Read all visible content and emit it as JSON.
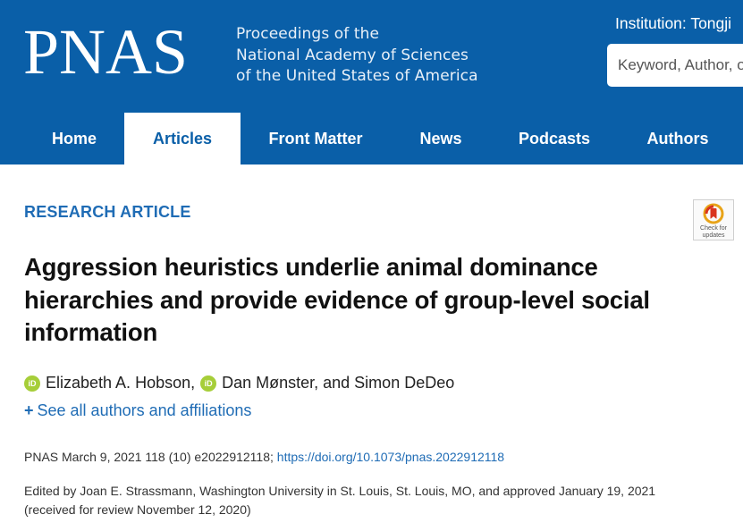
{
  "header": {
    "logo": "PNAS",
    "tagline": [
      "Proceedings of the",
      "National Academy of Sciences",
      "of the United States of America"
    ],
    "institution": "Institution: Tongji",
    "search_placeholder": "Keyword, Author, or DOI"
  },
  "nav": {
    "items": [
      {
        "label": "Home"
      },
      {
        "label": "Articles"
      },
      {
        "label": "Front Matter"
      },
      {
        "label": "News"
      },
      {
        "label": "Podcasts"
      },
      {
        "label": "Authors"
      }
    ],
    "active": "Articles"
  },
  "article": {
    "type": "RESEARCH ARTICLE",
    "check_updates": "Check for updates",
    "title": "Aggression heuristics underlie animal dominance hierarchies and provide evidence of group-level social information",
    "authors": {
      "author1": "Elizabeth A. Hobson,",
      "author2": "Dan Mønster, and Simon DeDeo"
    },
    "see_all_plus": "+",
    "see_all": "See all authors and affiliations",
    "citation_text": "PNAS March 9, 2021 118 (10) e2022912118;",
    "doi": "https://doi.org/10.1073/pnas.2022912118",
    "edited_by": "Edited by Joan E. Strassmann, Washington University in St. Louis, St. Louis, MO, and approved January 19, 2021",
    "received": "(received for review November 12, 2020)"
  },
  "colors": {
    "brand_blue": "#0a5fa8",
    "link_blue": "#1f6cb5",
    "orcid_green": "#a6ce39"
  }
}
